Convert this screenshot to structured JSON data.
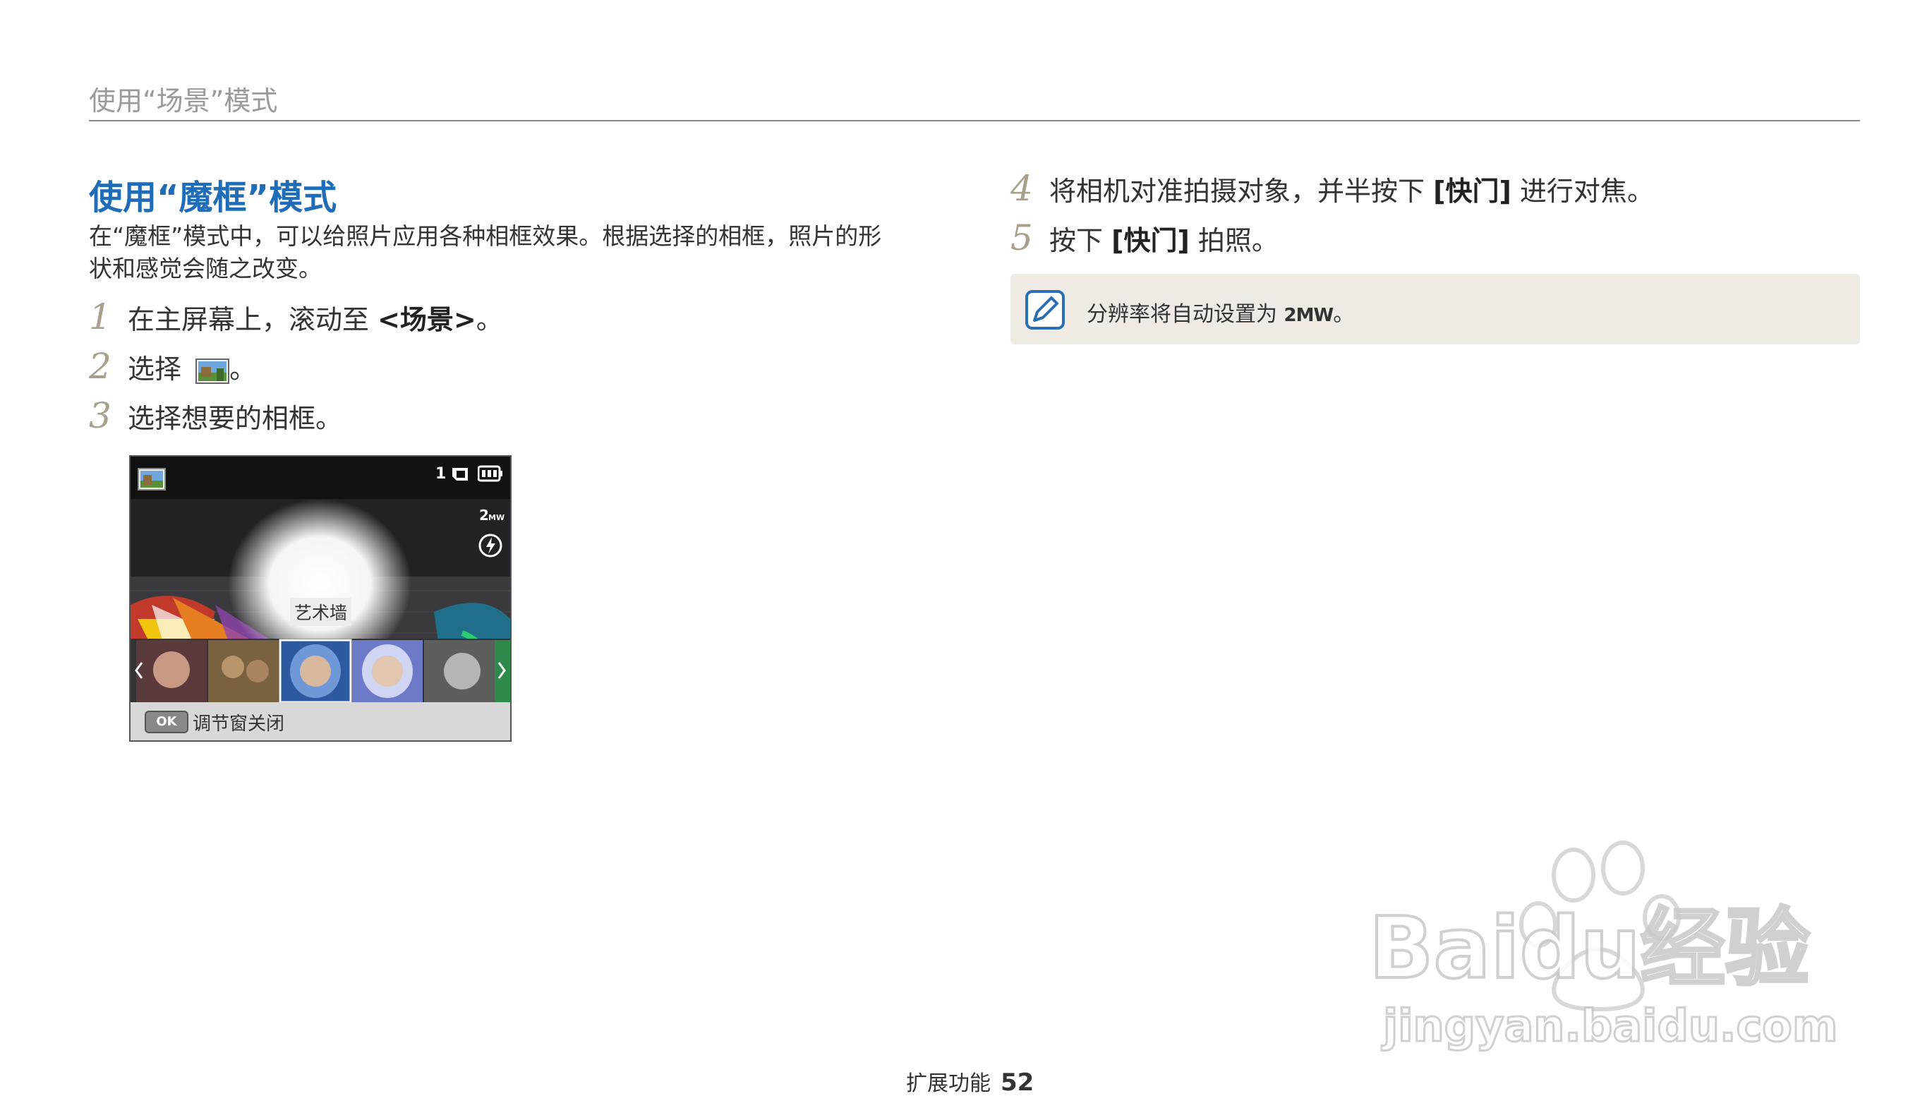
{
  "header": {
    "title": "使用“场景”模式"
  },
  "section": {
    "title": "使用“魔框”模式",
    "intro": "在“魔框”模式中，可以给照片应用各种相框效果。根据选择的相框，照片的形状和感觉会随之改变。"
  },
  "steps": [
    {
      "num": "1",
      "pre": "在主屏幕上，滚动至 ",
      "bold": "<场景>",
      "post": "。"
    },
    {
      "num": "2",
      "pre": "选择 ",
      "post": "。",
      "icon": "scene-frame-icon"
    },
    {
      "num": "3",
      "pre": "选择想要的相框。"
    },
    {
      "num": "4",
      "pre": "将相机对准拍摄对象，并半按下 ",
      "bold": "[快门]",
      "post": " 进行对焦。"
    },
    {
      "num": "5",
      "pre": "按下 ",
      "bold": "[快门]",
      "post": " 拍照。"
    }
  ],
  "note": {
    "icon": "note-pencil-icon",
    "text": "分辨率将自动设置为 ",
    "glyph": "2MW",
    "post": "。"
  },
  "screen": {
    "counter": "1",
    "resolution": "2MW",
    "frame_label": "艺术墙",
    "ok_key": "OK",
    "ok_text": "调节窗关闭",
    "thumbnails": 5
  },
  "watermark": {
    "brand": "Baidu经验",
    "url": "jingyan.baidu.com"
  },
  "footer": {
    "section": "扩展功能",
    "page": "52"
  },
  "colors": {
    "title_blue": "#1f6cb8",
    "step_number": "#a8a08a",
    "note_bg": "#efebe4"
  }
}
